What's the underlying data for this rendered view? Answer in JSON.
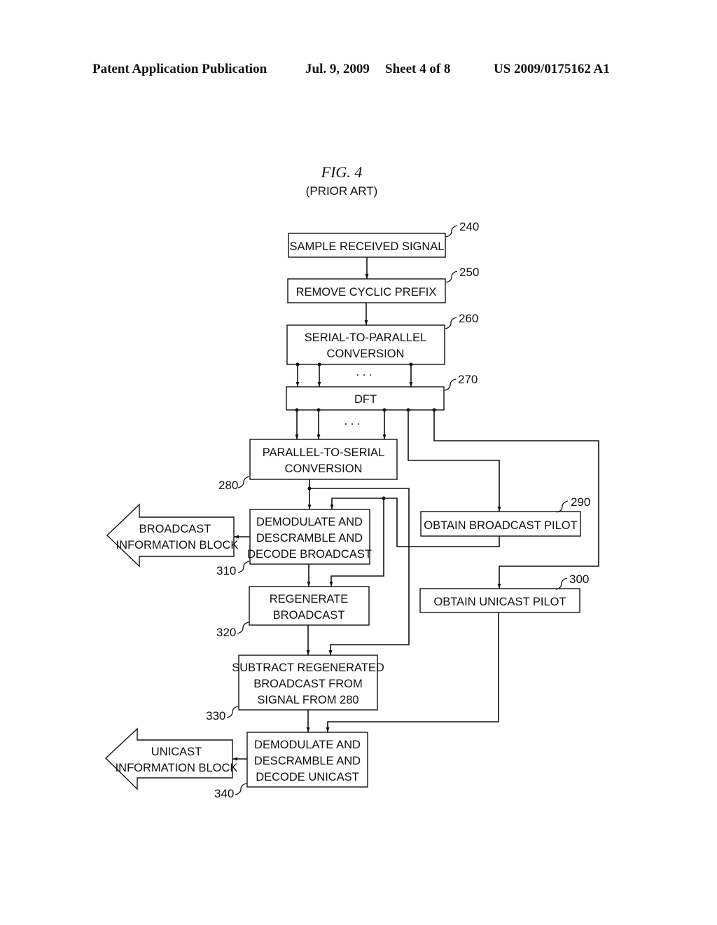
{
  "header": {
    "publication": "Patent Application Publication",
    "date": "Jul. 9, 2009",
    "sheet": "Sheet 4 of 8",
    "number": "US 2009/0175162 A1"
  },
  "figure": {
    "title": "FIG.   4",
    "subtitle": "(PRIOR ART)"
  },
  "blocks": {
    "b240": {
      "ref": "240",
      "lines": [
        "SAMPLE RECEIVED SIGNAL"
      ]
    },
    "b250": {
      "ref": "250",
      "lines": [
        "REMOVE CYCLIC PREFIX"
      ]
    },
    "b260": {
      "ref": "260",
      "lines": [
        "SERIAL-TO-PARALLEL",
        "CONVERSION"
      ]
    },
    "b270": {
      "ref": "270",
      "lines": [
        "DFT"
      ]
    },
    "b280": {
      "ref": "280",
      "lines": [
        "PARALLEL-TO-SERIAL",
        "CONVERSION"
      ]
    },
    "b290": {
      "ref": "290",
      "lines": [
        "OBTAIN BROADCAST PILOT"
      ]
    },
    "b300": {
      "ref": "300",
      "lines": [
        "OBTAIN UNICAST PILOT"
      ]
    },
    "b310": {
      "ref": "310",
      "lines": [
        "DEMODULATE AND",
        "DESCRAMBLE AND",
        "DECODE BROADCAST"
      ]
    },
    "b320": {
      "ref": "320",
      "lines": [
        "REGENERATE",
        "BROADCAST"
      ]
    },
    "b330": {
      "ref": "330",
      "lines": [
        "SUBTRACT REGENERATED",
        "BROADCAST FROM",
        "SIGNAL FROM 280"
      ]
    },
    "b340": {
      "ref": "340",
      "lines": [
        "DEMODULATE AND",
        "DESCRAMBLE AND",
        "DECODE UNICAST"
      ]
    }
  },
  "outputs": {
    "broadcast": {
      "lines": [
        "BROADCAST",
        "INFORMATION BLOCK"
      ]
    },
    "unicast": {
      "lines": [
        "UNICAST",
        "INFORMATION BLOCK"
      ]
    }
  },
  "ellipsis": ". . ."
}
